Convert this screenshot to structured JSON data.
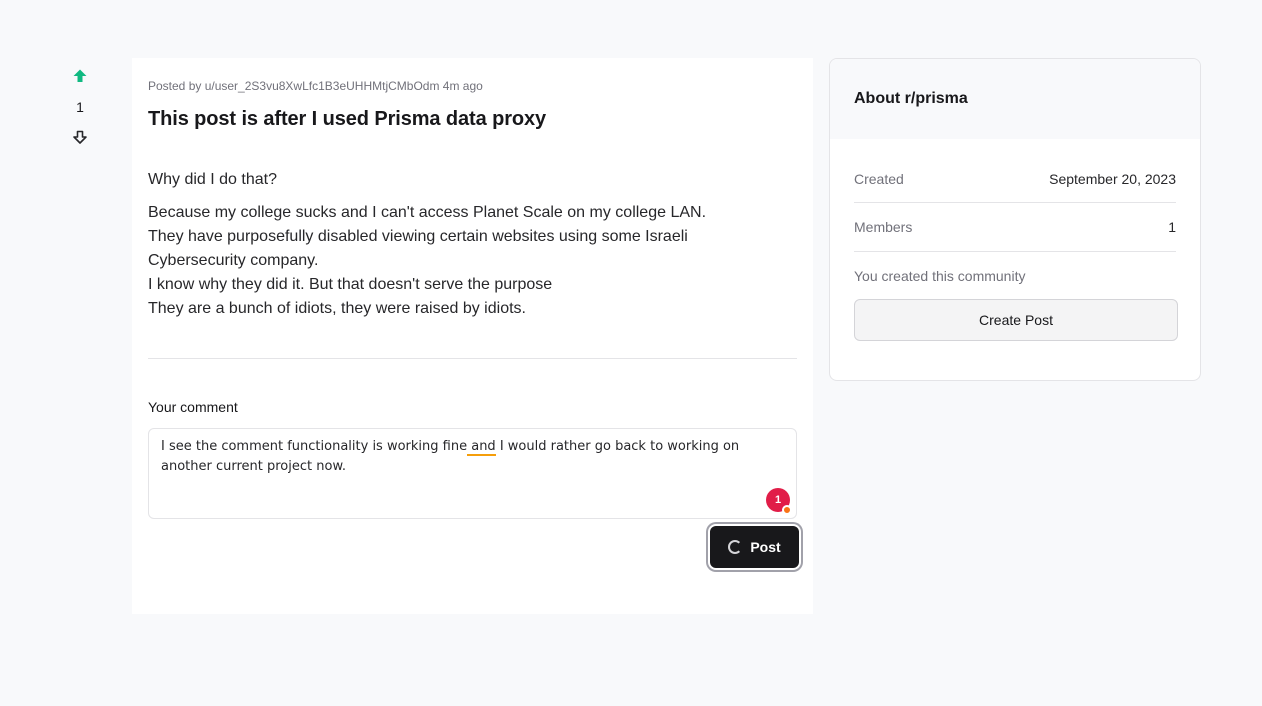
{
  "vote": {
    "count": "1",
    "upvote_color": "#10b981"
  },
  "post": {
    "meta": "Posted by u/user_2S3vu8XwLfc1B3eUHHMtjCMbOdm 4m ago",
    "title": "This post is after I used Prisma data proxy",
    "question": "Why did I do that?",
    "lines": [
      "Because my college sucks and I can't access Planet Scale on my college LAN.",
      "They have purposefully disabled viewing certain websites using some Israeli Cybersecurity company.",
      "I know why they did it. But that doesn't serve the purpose",
      "They are a bunch of idiots, they were raised by idiots."
    ]
  },
  "comment": {
    "label": "Your comment",
    "text_before": "I see the comment functionality is working fine",
    "text_flagged": " and",
    "text_after": " I would rather go back to working on another current project now.",
    "badge_count": "1",
    "submit_label": "Post"
  },
  "sidebar": {
    "title": "About r/prisma",
    "rows": [
      {
        "label": "Created",
        "value": "September 20, 2023"
      },
      {
        "label": "Members",
        "value": "1"
      }
    ],
    "note": "You created this community",
    "create_button": "Create Post"
  }
}
